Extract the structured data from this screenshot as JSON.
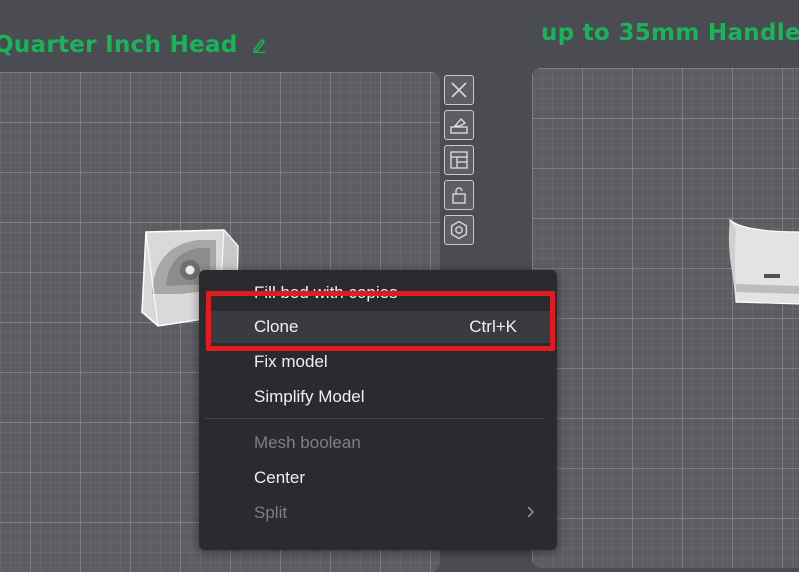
{
  "plates": {
    "left_title": "Quarter Inch Head",
    "right_title": "up to 35mm Handle"
  },
  "toolbar": {
    "icons": [
      "close-icon",
      "arrange-icon",
      "layout-icon",
      "lock-icon",
      "settings-icon"
    ]
  },
  "context_menu": {
    "items": [
      {
        "label": "Fill bed with copies",
        "shortcut": "",
        "state": "enabled"
      },
      {
        "label": "Clone",
        "shortcut": "Ctrl+K",
        "state": "highlighted"
      },
      {
        "label": "Fix model",
        "shortcut": "",
        "state": "enabled"
      },
      {
        "label": "Simplify Model",
        "shortcut": "",
        "state": "enabled"
      },
      {
        "label": "Mesh boolean",
        "shortcut": "",
        "state": "disabled"
      },
      {
        "label": "Center",
        "shortcut": "",
        "state": "enabled"
      },
      {
        "label": "Split",
        "shortcut": "",
        "state": "disabled",
        "submenu": true
      }
    ]
  },
  "colors": {
    "title_green": "#19b45a",
    "highlight_red": "#e11b22",
    "menu_bg": "#2a2b2f"
  }
}
